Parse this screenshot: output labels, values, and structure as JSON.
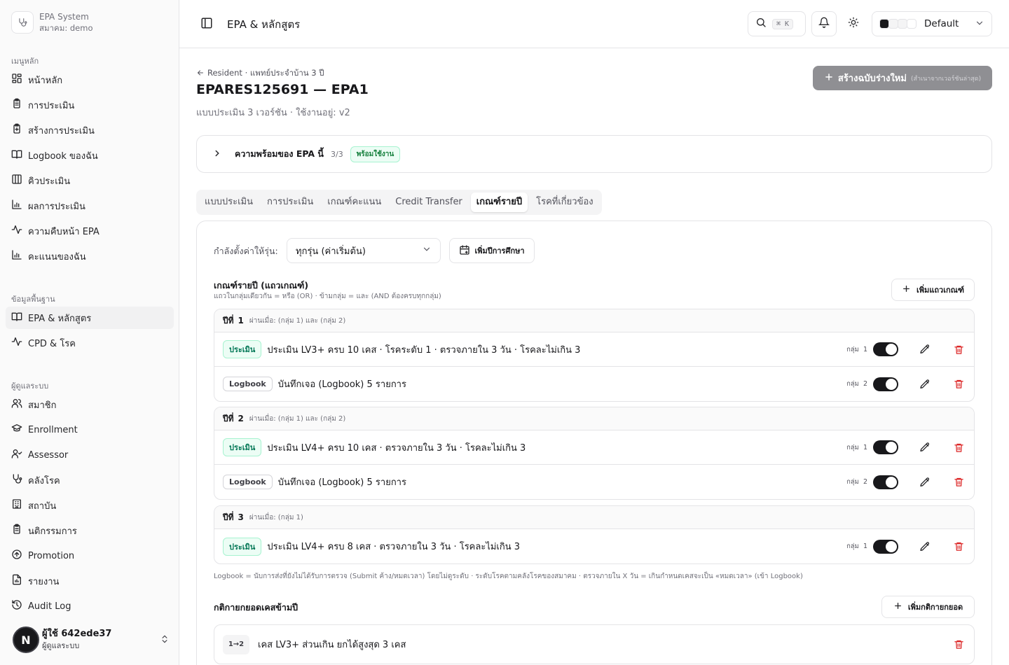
{
  "brand": {
    "name": "EPA System",
    "subtitle": "สมาคม: demo"
  },
  "sidebar": {
    "groups": [
      {
        "heading": "เมนูหลัก",
        "items": [
          {
            "label": "หน้าหลัก",
            "icon": "dashboard-icon"
          },
          {
            "label": "การประเมิน",
            "icon": "clipboard-icon"
          },
          {
            "label": "สร้างการประเมิน",
            "icon": "clipboard-plus-icon"
          },
          {
            "label": "Logbook ของฉัน",
            "icon": "book-icon"
          },
          {
            "label": "คิวประเมิน",
            "icon": "columns-icon"
          },
          {
            "label": "ผลการประเมิน",
            "icon": "bar-chart-icon"
          },
          {
            "label": "ความคืบหน้า EPA",
            "icon": "activity-icon"
          },
          {
            "label": "คะแนนของฉัน",
            "icon": "bar-chart-icon"
          }
        ]
      },
      {
        "heading": "ข้อมูลพื้นฐาน",
        "items": [
          {
            "label": "EPA & หลักสูตร",
            "icon": "book-icon",
            "active": true
          },
          {
            "label": "CPD & โรค",
            "icon": "activity-icon"
          }
        ]
      },
      {
        "heading": "ผู้ดูแลระบบ",
        "items": [
          {
            "label": "สมาชิก",
            "icon": "users-icon"
          },
          {
            "label": "Enrollment",
            "icon": "graduation-cap-icon"
          },
          {
            "label": "Assessor",
            "icon": "user-check-icon"
          },
          {
            "label": "คลังโรค",
            "icon": "stethoscope-icon"
          },
          {
            "label": "สถาบัน",
            "icon": "building-icon"
          },
          {
            "label": "นติกรรมการ",
            "icon": "clipboard-icon"
          },
          {
            "label": "Promotion",
            "icon": "arrow-up-circle-icon"
          },
          {
            "label": "รายงาน",
            "icon": "file-chart-icon"
          },
          {
            "label": "Audit Log",
            "icon": "history-icon"
          }
        ]
      }
    ],
    "user": {
      "initial": "N",
      "name": "ผู้ใช้ 642ede37",
      "role": "ผู้ดูแลระบบ"
    }
  },
  "header": {
    "title": "EPA & หลักสูตร",
    "search_shortcut": "⌘ K",
    "theme": {
      "label": "Default",
      "swatches": [
        "#18181b",
        "#f4f4f5",
        "#f4f4f5",
        "#ffffff"
      ]
    }
  },
  "page": {
    "breadcrumb": "Resident · แพทย์ประจำบ้าน 3 ปี",
    "title": "EPARES125691 — EPA1",
    "subtitle": "แบบประเมิน 3 เวอร์ชัน · ใช้งานอยู่: v2",
    "new_draft": {
      "label": "สร้างฉบับร่างใหม่",
      "hint": "(สำเนาจากเวอร์ชันล่าสุด)"
    },
    "readiness": {
      "title": "ความพร้อมของ EPA นี้",
      "count": "3/3",
      "badge": "พร้อมใช้งาน"
    },
    "tabs": [
      "แบบประเมิน",
      "การประเมิน",
      "เกณฑ์คะแนน",
      "Credit Transfer",
      "เกณฑ์รายปี",
      "โรคที่เกี่ยวข้อง"
    ],
    "active_tab": "เกณฑ์รายปี"
  },
  "panel": {
    "cohort_label": "กำลังตั้งค่าให้รุ่น:",
    "cohort_value": "ทุกรุ่น (ค่าเริ่มต้น)",
    "add_year": "เพิ่มปีการศึกษา",
    "criteria_title": "เกณฑ์รายปี (แถวเกณฑ์)",
    "criteria_desc": "แถวในกลุ่มเดียวกัน = หรือ (OR) · ข้ามกลุ่ม = และ (AND ต้องครบทุกกลุ่ม)",
    "add_row": "เพิ่มแถวเกณฑ์",
    "group_prefix": "กลุ่ม",
    "years": [
      {
        "label": "ปีที่",
        "num": "1",
        "pass": "ผ่านเมื่อ: (กลุ่ม 1) และ (กลุ่ม 2)",
        "rules": [
          {
            "type": "ประเมิน",
            "kind": "eval",
            "text": "ประเมิน LV3+ ครบ 10 เคส · โรคระดับ 1 · ตรวจภายใน 3 วัน · โรคละไม่เกิน 3",
            "group": "1"
          },
          {
            "type": "Logbook",
            "kind": "log",
            "text": "บันทึกเจอ (Logbook) 5 รายการ",
            "group": "2"
          }
        ]
      },
      {
        "label": "ปีที่",
        "num": "2",
        "pass": "ผ่านเมื่อ: (กลุ่ม 1) และ (กลุ่ม 2)",
        "rules": [
          {
            "type": "ประเมิน",
            "kind": "eval",
            "text": "ประเมิน LV4+ ครบ 10 เคส · ตรวจภายใน 3 วัน · โรคละไม่เกิน 3",
            "group": "1"
          },
          {
            "type": "Logbook",
            "kind": "log",
            "text": "บันทึกเจอ (Logbook) 5 รายการ",
            "group": "2"
          }
        ]
      },
      {
        "label": "ปีที่",
        "num": "3",
        "pass": "ผ่านเมื่อ: (กลุ่ม 1)",
        "rules": [
          {
            "type": "ประเมิน",
            "kind": "eval",
            "text": "ประเมิน LV4+ ครบ 8 เคส · ตรวจภายใน 3 วัน · โรคละไม่เกิน 3",
            "group": "1"
          }
        ]
      }
    ],
    "footnote": "Logbook = นับการส่งที่ยังไม่ได้รับการตรวจ (Submit ค้าง/หมดเวลา) โดยไม่ดูระดับ · ระดับโรคตามคลังโรคของสมาคม · ตรวจภายใน X วัน = เกินกำหนดเคสจะเป็น «หมดเวลา» (เข้า Logbook)",
    "carry_title": "กติกายกยอดเคสข้ามปี",
    "add_carry": "เพิ่มกติกายกยอด",
    "carry_rules": [
      {
        "range": "1→2",
        "text": "เคส LV3+ ส่วนเกิน ยกได้สูงสุด 3 เคส"
      }
    ]
  }
}
